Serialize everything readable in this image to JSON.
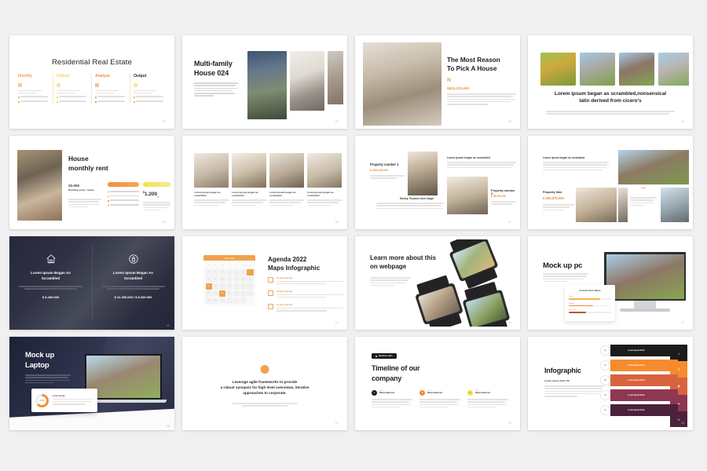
{
  "page": {
    "background": "#f0f0f1",
    "accent_orange": "#e8913c",
    "accent_yellow": "#f5e04e",
    "dark": "#232536"
  },
  "slides": [
    {
      "id": "residential-real-estate",
      "title": "Residential Real Estate",
      "page_number": "01",
      "columns": [
        {
          "label": "Identify",
          "color": "#f2a14e",
          "bullets": [
            "It's difficult to find examples",
            "It's difficult to find"
          ]
        },
        {
          "label": "Collect",
          "color": "#f5d04e",
          "bullets": [
            "It's difficult to find examples",
            "It's difficult to find"
          ]
        },
        {
          "label": "Analyze",
          "color": "#ef8b3c",
          "bullets": [
            "It's difficult to find examples",
            "It's difficult to find"
          ]
        },
        {
          "label": "Output",
          "color": "#2b2b2b",
          "bullets": [
            "It's difficult to find examples",
            "It's difficult to find"
          ]
        }
      ]
    },
    {
      "id": "multi-family-house",
      "title_line1": "Multi-family",
      "title_line2": "House 024",
      "body": "It's difficult to find examples of lorem ipsum in use before Cicero's de finibus, although McClintock says he remembers seeing it in 1914.",
      "page_number": "02"
    },
    {
      "id": "most-reason-pick-house",
      "title_line1": "The Most Reason",
      "title_line2": "To Pick A House",
      "mark": "N",
      "price": "$825,320,400",
      "body": "It's difficult to find examples of lorem ipsum in use before Cicero's de finibus, although McClintock says he remembers seeing it in 1914.",
      "page_number": "03"
    },
    {
      "id": "lorem-ipsum-scrambled-houses",
      "headline_line1": "Lorem ipsum began as scrambled,nonsensical",
      "headline_line2": "latin derived from cicero's",
      "subtext": "It's difficult to find examples of lorem ipsum in use before Cicero's de finibus",
      "page_number": "04"
    },
    {
      "id": "house-monthly-rent",
      "title_line1": "House",
      "title_line2": "monthly rent",
      "number": "23.000",
      "caption": "Building name : future",
      "tag_left": "Recommended",
      "tag_right": "Best Choice",
      "features": [
        "Lorem ipsum agile",
        "Chart framework",
        "Provide for the us",
        "Synopsis for high"
      ],
      "price": "1.200",
      "price_symbol": "$",
      "price_period": "/y",
      "page_number": "05"
    },
    {
      "id": "interior-grid",
      "headers": [
        "Lorem ipsum began as scrambled",
        "Lorem ipsum began as scrambled",
        "Lorem ipsum began as scrambled",
        "Lorem ipsum began as scrambled"
      ],
      "page_number": "06"
    },
    {
      "id": "property-numbers",
      "property1_label": "Property number 1",
      "property1_price": "$ 155,240,000",
      "property2_label": "Property number 2",
      "property2_price": "$ 98,400,000",
      "center_caption": "Money, Purpose And Usage",
      "top_caption": "Lorem ipsum began as scrambled",
      "page_number": "07"
    },
    {
      "id": "property-sale",
      "header": "Lorem ipsum began as scrambled",
      "sale_label": "Property Sale",
      "sale_price": "$ 450,675,000",
      "card_icon": "quote-icon",
      "page_number": "08"
    },
    {
      "id": "dark-two-column",
      "left": {
        "icon": "house-icon",
        "heading_line1": "Lorem Ipsum Began As",
        "heading_line2": "Scrambled",
        "price": "$ 8.400.000"
      },
      "right": {
        "icon": "lock-icon",
        "heading_line1": "Lorem Ipsum Began As",
        "heading_line2": "Scrambled",
        "price": "$ 12.400.000 / $ 8.200.000"
      },
      "page_number": "09"
    },
    {
      "id": "agenda-maps-infographic",
      "title_line1": "Agenda 2022",
      "title_line2": "Maps Infographic",
      "calendar_month": "June 2022",
      "calendar_weekdays": [
        "M",
        "T",
        "W",
        "T",
        "F",
        "S",
        "S"
      ],
      "highlighted_days": [
        7,
        15,
        24
      ],
      "items": [
        {
          "title": "At your effective",
          "body": "It's difficult to find examples of lorem ipsum in use before cicero's de finibus"
        },
        {
          "title": "At your effective",
          "body": "It's difficult to find examples of lorem ipsum in use before cicero's de finibus"
        },
        {
          "title": "At your effective",
          "body": "It's difficult to find examples of lorem ipsum in use before cicero's de finibus"
        }
      ],
      "page_number": "10"
    },
    {
      "id": "learn-more-webpage",
      "title_line1": "Learn more about this",
      "title_line2": "on webpage",
      "body": "LOREM IPSUM lorem ipsum agile frameworks, leveraging with a robust synopsis for high level overviews of iterative.",
      "page_number": "11"
    },
    {
      "id": "mock-up-pc",
      "title": "Mock up pc",
      "body": "LOREM IPSUM agile frameworks, leveraging with a robust synopsis for high level overviews of iterative.",
      "card_title": "Growth Chart Name",
      "bars": [
        {
          "label": "Sales",
          "value": "74%",
          "pct": 74,
          "color": "#f3b14e"
        },
        {
          "label": "Rentals",
          "value": "58%",
          "pct": 58,
          "color": "#ef8b3c"
        },
        {
          "label": "Investment",
          "value": "41%",
          "pct": 41,
          "color": "#c2522e"
        }
      ],
      "page_number": "12"
    },
    {
      "id": "mock-up-laptop",
      "title_line1": "Mock up",
      "title_line2": "Laptop",
      "body": "LOREM IPSUM lorem ipsum agile frameworks, leveraging with a robust synopsis for high level overviews of iterative.",
      "card_title": "Lorem ipsum",
      "card_body": "Lorem ipsum agile frameworks leveraging with a robust synopsis.",
      "donut_value": "64%",
      "donut_pct": 64,
      "page_number": "13"
    },
    {
      "id": "agile-quote",
      "icon": "quote-icon",
      "quote_line1": "Leverage agile frameworks to provide",
      "quote_line2": "a robust synopsis for high level overviews, iterative",
      "quote_line3": "approaches to corporate.",
      "subtext": "Leverage agile frameworks to provide a robust synopsis for high level overviews",
      "page_number": "14"
    },
    {
      "id": "timeline-company",
      "badge": "Business plan",
      "title_line1": "Timeline of our",
      "title_line2": "company",
      "steps": [
        {
          "num": "1",
          "date": "2020",
          "label": "Real estate text",
          "color": "#1b1b1b",
          "body": "Lorem ipsum agile frameworks that provides a robust synopsis for high level overviews."
        },
        {
          "num": "2",
          "date": "2021",
          "label": "Real estate text",
          "color": "#ef8b3c",
          "body": "Lorem ipsum agile frameworks that provides a robust synopsis for high level overviews."
        },
        {
          "num": "3",
          "date": "2022",
          "label": "Real estate text",
          "color": "#f5e04e",
          "body": "Lorem ipsum agile frameworks that provides a robust synopsis for high level overviews."
        }
      ],
      "page_number": "15"
    },
    {
      "id": "infographic-funnel",
      "title": "Infographic",
      "subtitle": "Lorem ipsum Dolor Sit",
      "body": "LOREM IPSUM dolor sit amet, consectetur adipiscing elit, sed diam nonummy nibh euismod tincidunt ut laoreet dolore magna aliquam erat volutpat.",
      "steps": [
        {
          "num": "01",
          "label": "Lorem Ipsum Dolor",
          "color": "#1b1b1b"
        },
        {
          "num": "02",
          "label": "Lorem Ipsum Dolor",
          "color": "#f58b2e"
        },
        {
          "num": "03",
          "label": "Lorem Ipsum Dolor",
          "color": "#d9633f"
        },
        {
          "num": "04",
          "label": "Lorem Ipsum Dolor",
          "color": "#8e3752"
        },
        {
          "num": "05",
          "label": "Lorem Ipsum Dolor",
          "color": "#4b2239"
        }
      ],
      "side_icons": [
        "download-icon",
        "lock-icon",
        "camera-icon",
        "cloud-icon",
        "wifi-icon"
      ],
      "page_number": "16"
    }
  ]
}
